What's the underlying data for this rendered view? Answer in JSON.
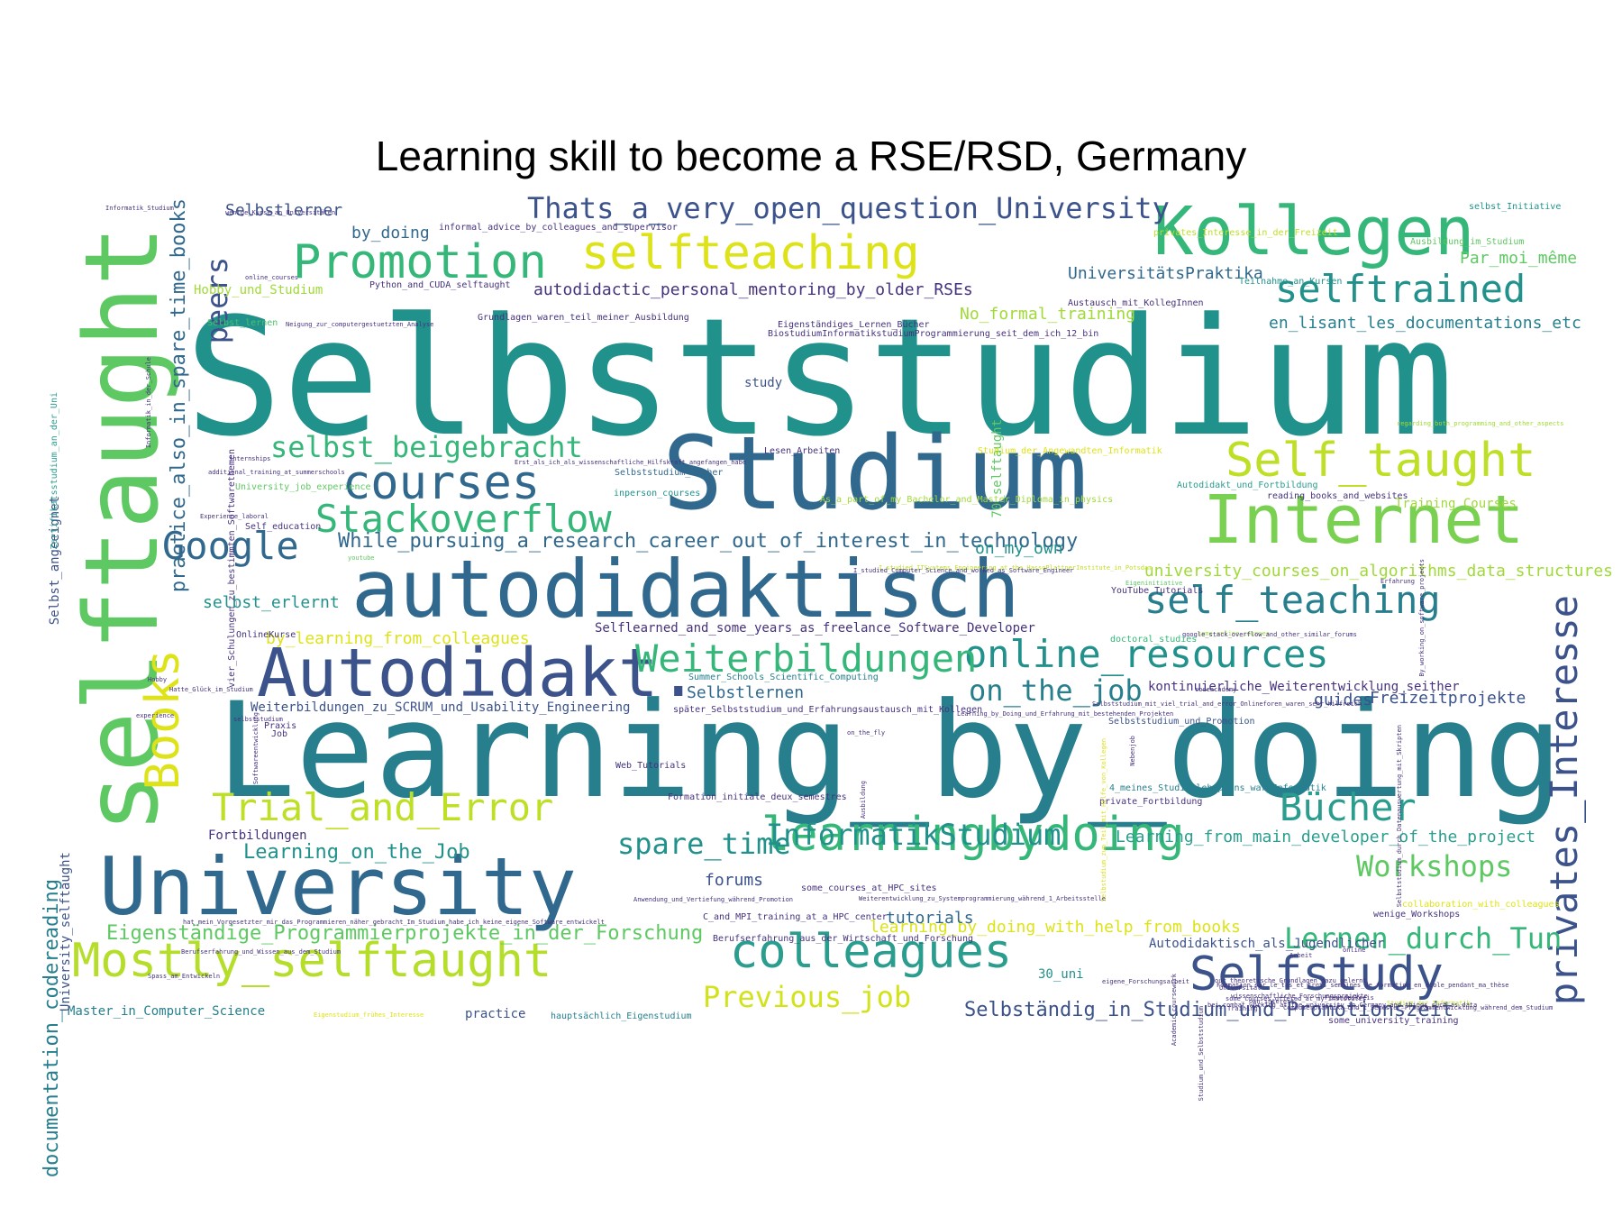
{
  "title": "Learning skill to become a RSE/RSD, Germany",
  "colormap": [
    "#440154",
    "#46327e",
    "#365c8d",
    "#277f8e",
    "#1fa187",
    "#4ac16d",
    "#a0da39",
    "#fde725"
  ],
  "words": [
    {
      "text": "Selbststudium",
      "weight": 100,
      "color": "#21918c"
    },
    {
      "text": "Learning_by_doing",
      "weight": 78,
      "color": "#277f8e"
    },
    {
      "text": "selftaught",
      "weight": 62,
      "color": "#5ec962",
      "vertical": true
    },
    {
      "text": "Studium",
      "weight": 62,
      "color": "#31688e"
    },
    {
      "text": "University",
      "weight": 50,
      "color": "#31688e"
    },
    {
      "text": "autodidaktisch",
      "weight": 50,
      "color": "#31688e"
    },
    {
      "text": "Internet",
      "weight": 47,
      "color": "#7ad151"
    },
    {
      "text": "Autodidakt.",
      "weight": 39,
      "color": "#3b528b"
    },
    {
      "text": "Kollegen",
      "weight": 39,
      "color": "#35b779"
    },
    {
      "text": "selfteaching",
      "weight": 37,
      "color": "#dde318"
    },
    {
      "text": "learningbydoing",
      "weight": 36,
      "color": "#35b779"
    },
    {
      "text": "colleagues",
      "weight": 34,
      "color": "#2a9d8f"
    },
    {
      "text": "Mostly_selftaught",
      "weight": 34,
      "color": "#b5de2b"
    },
    {
      "text": "Books",
      "weight": 34,
      "color": "#dde318",
      "vertical": true
    },
    {
      "text": "Self_taught",
      "weight": 30,
      "color": "#bddf26"
    },
    {
      "text": "Promotion",
      "weight": 30,
      "color": "#35b779"
    },
    {
      "text": "courses",
      "weight": 30,
      "color": "#31688e"
    },
    {
      "text": "Selfstudy",
      "weight": 30,
      "color": "#3b528b"
    },
    {
      "text": "Trial_and_Error",
      "weight": 28,
      "color": "#bddf26"
    },
    {
      "text": "Google",
      "weight": 28,
      "color": "#31688e"
    },
    {
      "text": "Stackoverflow",
      "weight": 28,
      "color": "#35b779"
    },
    {
      "text": "self_teaching",
      "weight": 28,
      "color": "#277f8e"
    },
    {
      "text": "online_resources",
      "weight": 28,
      "color": "#21918c"
    },
    {
      "text": "Bücher",
      "weight": 28,
      "color": "#2a9d8f"
    },
    {
      "text": "selftrained",
      "weight": 26,
      "color": "#21918c"
    },
    {
      "text": "Weiterbildungen",
      "weight": 24,
      "color": "#35b779"
    },
    {
      "text": "privates_Interesse",
      "weight": 24,
      "color": "#3b528b",
      "vertical": true
    },
    {
      "text": "InformatikStudium",
      "weight": 22,
      "color": "#21918c"
    },
    {
      "text": "Previous_job",
      "weight": 22,
      "color": "#d2e21b"
    },
    {
      "text": "selbst_beigebracht",
      "weight": 20,
      "color": "#35b779"
    },
    {
      "text": "Workshops",
      "weight": 20,
      "color": "#5ec962"
    },
    {
      "text": "Thats_a_very_open_question_University",
      "weight": 18,
      "color": "#3b528b"
    },
    {
      "text": "spare_time",
      "weight": 18,
      "color": "#21918c"
    },
    {
      "text": "Lernen_durch_Tun",
      "weight": 18,
      "color": "#35b779"
    },
    {
      "text": "on_the_job",
      "weight": 18,
      "color": "#277f8e"
    },
    {
      "text": "peers",
      "weight": 18,
      "color": "#3b528b",
      "vertical": true
    },
    {
      "text": "documentation_codereading",
      "weight": 15,
      "color": "#277f8e",
      "vertical": true
    },
    {
      "text": "practice_also_in_spare_time_books",
      "weight": 14,
      "color": "#31688e",
      "vertical": true
    },
    {
      "text": "While_pursuing_a_research_career_out_of_interest_in_technology",
      "weight": 14,
      "color": "#31688e"
    },
    {
      "text": "Learning_on_the_Job",
      "weight": 15,
      "color": "#21918c"
    },
    {
      "text": "Selbständig_in_Studium_und_Promotionszeit",
      "weight": 14,
      "color": "#3b528b"
    },
    {
      "text": "Eigenständige_Programmierprojekte_in_der_Forschung",
      "weight": 14,
      "color": "#5ec962"
    },
    {
      "text": "Learning_from_main_developer_of_the_project",
      "weight": 13,
      "color": "#2a9d8f"
    },
    {
      "text": "autodidactic_personal_mentoring_by_older_RSEs",
      "weight": 13,
      "color": "#46327e"
    },
    {
      "text": "en_lisant_les_documentations_etc",
      "weight": 13,
      "color": "#277f8e"
    },
    {
      "text": "university_courses_on_algorithms_data_structures",
      "weight": 13,
      "color": "#a0da39"
    },
    {
      "text": "learning_by_doing_with_help_from_books",
      "weight": 13,
      "color": "#dde318"
    },
    {
      "text": "by_learning_from_colleagues",
      "weight": 13,
      "color": "#dde318"
    },
    {
      "text": "Selbstlernen",
      "weight": 12,
      "color": "#31688e"
    },
    {
      "text": "Selbstlerner",
      "weight": 12,
      "color": "#3b528b"
    },
    {
      "text": "selbst_erlernt",
      "weight": 12,
      "color": "#21918c"
    },
    {
      "text": "by_doing",
      "weight": 12,
      "color": "#31688e"
    },
    {
      "text": "No_formal_training",
      "weight": 12,
      "color": "#a0da39"
    },
    {
      "text": "UniversitätsPraktika",
      "weight": 12,
      "color": "#31688e"
    },
    {
      "text": "Par_moi_même",
      "weight": 12,
      "color": "#5ec962"
    },
    {
      "text": "Hobby_und_Studium",
      "weight": 11,
      "color": "#a0da39"
    },
    {
      "text": "Freizeitprojekte",
      "weight": 12,
      "color": "#3b528b"
    },
    {
      "text": "guides",
      "weight": 12,
      "color": "#3b528b"
    },
    {
      "text": "on_my_own",
      "weight": 12,
      "color": "#21918c"
    },
    {
      "text": "tutorials",
      "weight": 12,
      "color": "#31688e"
    },
    {
      "text": "forums",
      "weight": 12,
      "color": "#3b528b"
    },
    {
      "text": "study",
      "weight": 11,
      "color": "#3b528b"
    },
    {
      "text": "Training_Courses",
      "weight": 11,
      "color": "#a0da39"
    },
    {
      "text": "Fortbildungen",
      "weight": 10,
      "color": "#46327e"
    },
    {
      "text": "Master_in_Computer_Science",
      "weight": 10,
      "color": "#277f8e"
    },
    {
      "text": "University_selftaught",
      "weight": 10,
      "color": "#3b528b",
      "vertical": true
    },
    {
      "text": "70_selftaught",
      "weight": 10,
      "color": "#5ec962",
      "vertical": true
    },
    {
      "text": "Selbst_angeeignet",
      "weight": 9,
      "color": "#3b528b",
      "vertical": true
    },
    {
      "text": "Weiterbildungen_zu_SCRUM_und_Usability_Engineering",
      "weight": 9,
      "color": "#3b528b"
    },
    {
      "text": "Selflearned_and_some_years_as_freelance_Software_Developer",
      "weight": 9,
      "color": "#46327e"
    },
    {
      "text": "kontinuierliche_Weiterentwicklung_seither",
      "weight": 9,
      "color": "#46327e"
    },
    {
      "text": "Summer_Schools_Scientific_Computing",
      "weight": 8,
      "color": "#277f8e"
    },
    {
      "text": "Selbststudium_und_Promotion",
      "weight": 8,
      "color": "#3b528b"
    },
    {
      "text": "practice",
      "weight": 11,
      "color": "#3b528b"
    },
    {
      "text": "30_uni",
      "weight": 10,
      "color": "#21918c"
    },
    {
      "text": "Autodidaktisch_als_Jugendlicher",
      "weight": 10,
      "color": "#3b528b"
    },
    {
      "text": "C_and_MPI_training_at_a_HPC_center",
      "weight": 8,
      "color": "#46327e"
    },
    {
      "text": "reading_books_and_websites",
      "weight": 8,
      "color": "#46327e"
    },
    {
      "text": "Autodidakt_und_Fortbildung",
      "weight": 7,
      "color": "#2a9d8f"
    },
    {
      "text": "Lesen_Arbeiten",
      "weight": 7,
      "color": "#46327e"
    },
    {
      "text": "Selbststudium_Bücher",
      "weight": 6,
      "color": "#31688e"
    },
    {
      "text": "inperson_courses",
      "weight": 8,
      "color": "#21918c"
    },
    {
      "text": "Python_and_CUDA_selftaught",
      "weight": 8,
      "color": "#46327e"
    },
    {
      "text": "Grundlagen_waren_teil_meiner_Ausbildung",
      "weight": 6,
      "color": "#46327e"
    },
    {
      "text": "BiostudiumInformatikstudiumProgrammierung_seit_dem_ich_12_bin",
      "weight": 7,
      "color": "#46327e"
    },
    {
      "text": "Eigenständiges_Lernen_Bücher",
      "weight": 6,
      "color": "#46327e"
    },
    {
      "text": "Austausch_mit_KollegInnen",
      "weight": 6,
      "color": "#46327e"
    },
    {
      "text": "Teilnahme_an_Kursen",
      "weight": 7,
      "color": "#21918c"
    },
    {
      "text": "selbst_Initiative",
      "weight": 8,
      "color": "#21918c"
    },
    {
      "text": "Ausbildung_im_Studium",
      "weight": 6,
      "color": "#5ec962"
    },
    {
      "text": "privates_Interesse_in_der_Freizeit",
      "weight": 7,
      "color": "#bddf26"
    },
    {
      "text": "informal_advice_by_colleagues_and_supervisor",
      "weight": 6,
      "color": "#46327e"
    },
    {
      "text": "wenige_Kurse_an_Universitäten",
      "weight": 5,
      "color": "#46327e"
    },
    {
      "text": "Informatik_Studium",
      "weight": 5,
      "color": "#46327e"
    },
    {
      "text": "Selbst_lernen",
      "weight": 6,
      "color": "#4ac16d"
    },
    {
      "text": "Neigung_zur_computergestuetzten_Analyse",
      "weight": 4,
      "color": "#46327e"
    },
    {
      "text": "online_courses",
      "weight": 4,
      "color": "#46327e"
    },
    {
      "text": "Zertifikatsstudium_an_der_Uni",
      "weight": 6,
      "color": "#2a9d8f",
      "vertical": true
    },
    {
      "text": "Informatik_in_der_Schule",
      "weight": 5,
      "color": "#46327e",
      "vertical": true
    },
    {
      "text": "vier_Schulungen_zu_bestimmten_Softwarethemen",
      "weight": 6,
      "color": "#46327e",
      "vertical": true
    },
    {
      "text": "internships",
      "weight": 5,
      "color": "#46327e"
    },
    {
      "text": "additional_training_at_summerschools",
      "weight": 4,
      "color": "#46327e"
    },
    {
      "text": "University_job_experience",
      "weight": 7,
      "color": "#5ec962"
    },
    {
      "text": "Experience_laboral",
      "weight": 4,
      "color": "#46327e"
    },
    {
      "text": "Self_education",
      "weight": 6,
      "color": "#46327e"
    },
    {
      "text": "youtube",
      "weight": 5,
      "color": "#5ec962"
    },
    {
      "text": "Erst_als_ich_als_wissenschaftliche_Hilfskraft_angefangen_habe",
      "weight": 5,
      "color": "#46327e"
    },
    {
      "text": "Studium_der_Angewandten_Informatik",
      "weight": 6,
      "color": "#dde318"
    },
    {
      "text": "As_a_part_of_my_Bachelor_and_Master_Diploma_in_physics",
      "weight": 7,
      "color": "#a0da39"
    },
    {
      "text": "I_studied_ITSystems_Engineering_at_the_HassoPlattnerInstitute_in_Potsdam",
      "weight": 5,
      "color": "#bddf26"
    },
    {
      "text": "I_studied_Computer_Science_and_worked_as_Software_Engineer",
      "weight": 4,
      "color": "#46327e"
    },
    {
      "text": "YouTube_Tutorials",
      "weight": 6,
      "color": "#46327e"
    },
    {
      "text": "Eigeninitiative",
      "weight": 4,
      "color": "#5ec962"
    },
    {
      "text": "some_online_courses",
      "weight": 5,
      "color": "#a0da39"
    },
    {
      "text": "google_stack_overflow_and_other_similar_forums",
      "weight": 5,
      "color": "#46327e"
    },
    {
      "text": "doctoral_studies",
      "weight": 6,
      "color": "#35b779"
    },
    {
      "text": "codeacademy",
      "weight": 4,
      "color": "#46327e"
    },
    {
      "text": "Selbststudium_mit_viel_trial_and_error_Onlineforen_waren_sehr_hilfreich",
      "weight": 5,
      "color": "#46327e"
    },
    {
      "text": "Learning_by_Doing_und_Erfahrung_mit_bestehenden_Projekten",
      "weight": 4,
      "color": "#46327e"
    },
    {
      "text": "später_Selbststudium_und_Erfahrungsaustausch_mit_Kollegen",
      "weight": 6,
      "color": "#46327e"
    },
    {
      "text": "4_meines_Studienlehrplans_war_Informatik",
      "weight": 6,
      "color": "#277f8e"
    },
    {
      "text": "private_Fortbildung",
      "weight": 6,
      "color": "#46327e"
    },
    {
      "text": "Formation_initiale_deux_semestres",
      "weight": 6,
      "color": "#46327e"
    },
    {
      "text": "Web_Tutorials",
      "weight": 6,
      "color": "#46327e"
    },
    {
      "text": "Job",
      "weight": 6,
      "color": "#46327e"
    },
    {
      "text": "OnlineKurse",
      "weight": 6,
      "color": "#46327e"
    },
    {
      "text": "selbststudium",
      "weight": 5,
      "color": "#46327e"
    },
    {
      "text": "Praxis",
      "weight": 6,
      "color": "#46327e"
    },
    {
      "text": "Hatte_Glück_im_Studium",
      "weight": 4,
      "color": "#46327e"
    },
    {
      "text": "Hobby",
      "weight": 3,
      "color": "#46327e"
    },
    {
      "text": "experience",
      "weight": 4,
      "color": "#46327e"
    },
    {
      "text": "Softwareentwicklung",
      "weight": 4,
      "color": "#46327e",
      "vertical": true
    },
    {
      "text": "Selbstudium_zum_Teil_mit_Hilfe_von_Kollegen",
      "weight": 4,
      "color": "#dde318",
      "vertical": true
    },
    {
      "text": "Nebenjob",
      "weight": 5,
      "color": "#46327e",
      "vertical": true
    },
    {
      "text": "Ausbildung",
      "weight": 3,
      "color": "#46327e",
      "vertical": true
    },
    {
      "text": "on_the_fly",
      "weight": 4,
      "color": "#46327e"
    },
    {
      "text": "hat_mein_Vorgesetzter_mir_das_Programmieren_näher_gebracht_Im_Studium_habe_ich_keine_eigene_Software_entwickelt",
      "weight": 4,
      "color": "#46327e"
    },
    {
      "text": "Berufserfahrung_und_Wissen_aus_dem_Studium",
      "weight": 4,
      "color": "#46327e"
    },
    {
      "text": "Spass_am_Entwickeln",
      "weight": 4,
      "color": "#46327e"
    },
    {
      "text": "Anwendung_und_Vertiefung_während_Promotion",
      "weight": 5,
      "color": "#46327e"
    },
    {
      "text": "Eigenstudium_frühes_Interesse",
      "weight": 3,
      "color": "#dde318"
    },
    {
      "text": "hauptsächlich_Eigenstudium",
      "weight": 6,
      "color": "#277f8e"
    },
    {
      "text": "Berufserfahrung_aus_der_Wirtschaft_und_Forschung",
      "weight": 6,
      "color": "#46327e"
    },
    {
      "text": "eigene_Forschungsarbeit",
      "weight": 3,
      "color": "#46327e"
    },
    {
      "text": "some_university_training",
      "weight": 6,
      "color": "#46327e"
    },
    {
      "text": "Computerpraktika_und_1_Semester_Programmentwicklung_während_dem_Studium",
      "weight": 5,
      "color": "#46327e"
    },
    {
      "text": "Studium_der_Informatik",
      "weight": 5,
      "color": "#bddf26"
    },
    {
      "text": "Arbeit",
      "weight": 3,
      "color": "#46327e"
    },
    {
      "text": "collaboration_with_colleagues",
      "weight": 6,
      "color": "#dde318"
    },
    {
      "text": "wenige_Workshops",
      "weight": 6,
      "color": "#46327e"
    },
    {
      "text": "some_courses_at_HPC_sites",
      "weight": 6,
      "color": "#46327e"
    },
    {
      "text": "Weiterentwicklung_zu_Systemprogrammierung_während_1_Arbeitsstelle",
      "weight": 5,
      "color": "#46327e"
    },
    {
      "text": "regarding_both_programming_and_other_aspects",
      "weight": 3,
      "color": "#a0da39"
    },
    {
      "text": "Erfahrung",
      "weight": 5,
      "color": "#46327e"
    },
    {
      "text": "By_working_on_software_projects",
      "weight": 5,
      "color": "#46327e",
      "vertical": true
    },
    {
      "text": "Selbststudium_durch_Datenauswertung_mit_Skripten",
      "weight": 5,
      "color": "#46327e",
      "vertical": true
    },
    {
      "text": "Studium_und_Selbststudium",
      "weight": 5,
      "color": "#46327e",
      "vertical": true
    },
    {
      "text": "Formation_sur_le_tas_et_trois_semaines_de_formation_en_école_pendant_ma_thèse",
      "weight": 3,
      "color": "#46327e"
    },
    {
      "text": "Freundeskreis",
      "weight": 3,
      "color": "#46327e"
    },
    {
      "text": "wissenschaftliche_Forschungsprojekte",
      "weight": 3,
      "color": "#46327e"
    },
    {
      "text": "Training",
      "weight": 3,
      "color": "#46327e"
    },
    {
      "text": "online",
      "weight": 3,
      "color": "#46327e"
    },
    {
      "text": "Universität",
      "weight": 3,
      "color": "#46327e"
    },
    {
      "text": "some_courses_offered_at_my_institutes",
      "weight": 3,
      "color": "#46327e"
    },
    {
      "text": "own_interest",
      "weight": 3,
      "color": "#46327e"
    },
    {
      "text": "bei_combat_working_at_the_university_in_Germany_and_things_such_as_data",
      "weight": 3,
      "color": "#46327e"
    },
    {
      "text": "our_theoretische_Grundlagen_dazu_gelernt",
      "weight": 3,
      "color": "#46327e"
    },
    {
      "text": "Academic_coursework",
      "weight": 3,
      "color": "#46327e",
      "vertical": true
    }
  ]
}
